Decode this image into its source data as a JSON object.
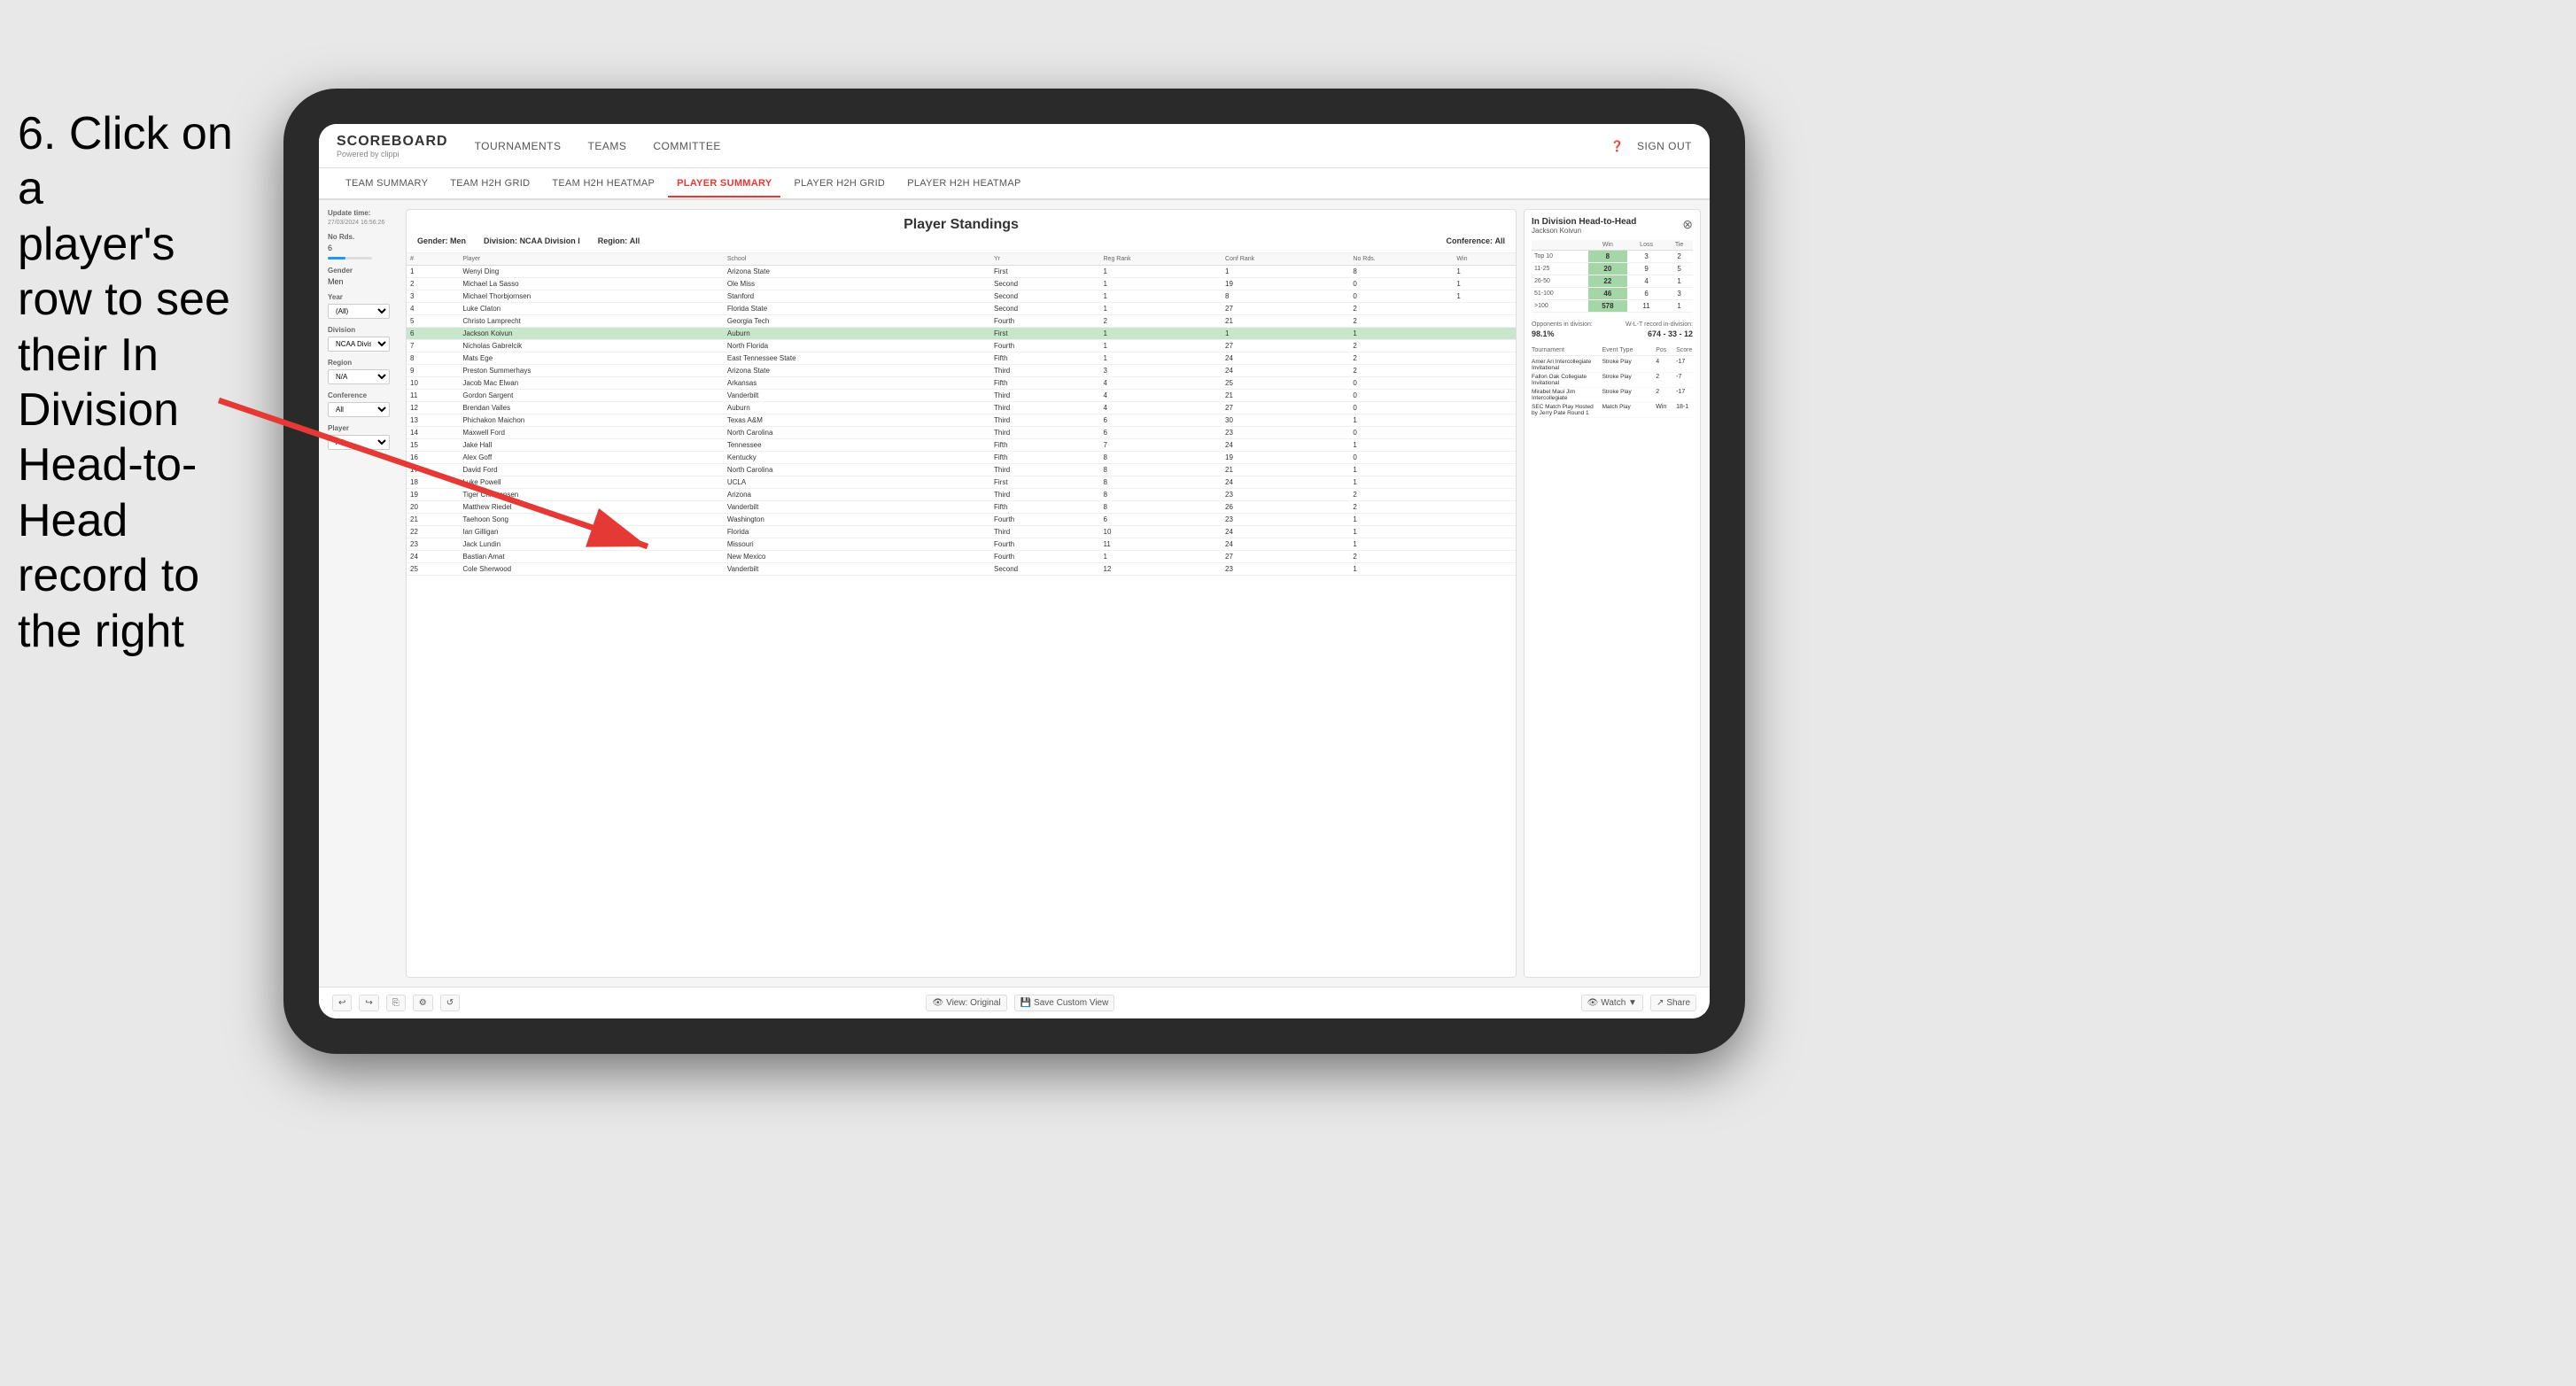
{
  "instruction": {
    "line1": "6. Click on a",
    "line2": "player's row to see",
    "line3": "their In Division",
    "line4": "Head-to-Head",
    "line5": "record to the right"
  },
  "nav": {
    "logo": "SCOREBOARD",
    "logo_sub": "Powered by clippi",
    "items": [
      "TOURNAMENTS",
      "TEAMS",
      "COMMITTEE"
    ],
    "sign_out": "Sign out"
  },
  "sub_nav": {
    "items": [
      "TEAM SUMMARY",
      "TEAM H2H GRID",
      "TEAM H2H HEATMAP",
      "PLAYER SUMMARY",
      "PLAYER H2H GRID",
      "PLAYER H2H HEATMAP"
    ],
    "active": "PLAYER SUMMARY"
  },
  "sidebar": {
    "update_label": "Update time:",
    "update_time": "27/03/2024 16:56:26",
    "no_rds_label": "No Rds.",
    "no_rds_value": "6",
    "gender_label": "Gender",
    "gender_value": "Men",
    "year_label": "Year",
    "year_value": "(All)",
    "division_label": "Division",
    "division_value": "NCAA Division I",
    "region_label": "Region",
    "region_value": "N/A",
    "conference_label": "Conference",
    "conference_value": "(All)",
    "player_label": "Player",
    "player_value": "(All)"
  },
  "standings": {
    "title": "Player Standings",
    "filters": {
      "gender_label": "Gender:",
      "gender_value": "Men",
      "division_label": "Division:",
      "division_value": "NCAA Division I",
      "region_label": "Region:",
      "region_value": "All",
      "conference_label": "Conference:",
      "conference_value": "All"
    },
    "columns": [
      "#",
      "Player",
      "School",
      "Yr",
      "Reg Rank",
      "Conf Rank",
      "No Rds.",
      "Win"
    ],
    "rows": [
      {
        "num": "1",
        "player": "Wenyi Ding",
        "school": "Arizona State",
        "yr": "First",
        "reg": "1",
        "conf": "1",
        "rds": "8",
        "win": "1"
      },
      {
        "num": "2",
        "player": "Michael La Sasso",
        "school": "Ole Miss",
        "yr": "Second",
        "reg": "1",
        "conf": "19",
        "rds": "0",
        "win": "1"
      },
      {
        "num": "3",
        "player": "Michael Thorbjornsen",
        "school": "Stanford",
        "yr": "Second",
        "reg": "1",
        "conf": "8",
        "rds": "0",
        "win": "1"
      },
      {
        "num": "4",
        "player": "Luke Claton",
        "school": "Florida State",
        "yr": "Second",
        "reg": "1",
        "conf": "27",
        "rds": "2",
        "win": ""
      },
      {
        "num": "5",
        "player": "Christo Lamprecht",
        "school": "Georgia Tech",
        "yr": "Fourth",
        "reg": "2",
        "conf": "21",
        "rds": "2",
        "win": ""
      },
      {
        "num": "6",
        "player": "Jackson Koivun",
        "school": "Auburn",
        "yr": "First",
        "reg": "1",
        "conf": "1",
        "rds": "1",
        "win": "",
        "highlighted": true
      },
      {
        "num": "7",
        "player": "Nicholas Gabrelcik",
        "school": "North Florida",
        "yr": "Fourth",
        "reg": "1",
        "conf": "27",
        "rds": "2",
        "win": ""
      },
      {
        "num": "8",
        "player": "Mats Ege",
        "school": "East Tennessee State",
        "yr": "Fifth",
        "reg": "1",
        "conf": "24",
        "rds": "2",
        "win": ""
      },
      {
        "num": "9",
        "player": "Preston Summerhays",
        "school": "Arizona State",
        "yr": "Third",
        "reg": "3",
        "conf": "24",
        "rds": "2",
        "win": ""
      },
      {
        "num": "10",
        "player": "Jacob Mac Elwan",
        "school": "Arkansas",
        "yr": "Fifth",
        "reg": "4",
        "conf": "25",
        "rds": "0",
        "win": ""
      },
      {
        "num": "11",
        "player": "Gordon Sargent",
        "school": "Vanderbilt",
        "yr": "Third",
        "reg": "4",
        "conf": "21",
        "rds": "0",
        "win": ""
      },
      {
        "num": "12",
        "player": "Brendan Valles",
        "school": "Auburn",
        "yr": "Third",
        "reg": "4",
        "conf": "27",
        "rds": "0",
        "win": ""
      },
      {
        "num": "13",
        "player": "Phichakon Maichon",
        "school": "Texas A&M",
        "yr": "Third",
        "reg": "6",
        "conf": "30",
        "rds": "1",
        "win": ""
      },
      {
        "num": "14",
        "player": "Maxwell Ford",
        "school": "North Carolina",
        "yr": "Third",
        "reg": "6",
        "conf": "23",
        "rds": "0",
        "win": ""
      },
      {
        "num": "15",
        "player": "Jake Hall",
        "school": "Tennessee",
        "yr": "Fifth",
        "reg": "7",
        "conf": "24",
        "rds": "1",
        "win": ""
      },
      {
        "num": "16",
        "player": "Alex Goff",
        "school": "Kentucky",
        "yr": "Fifth",
        "reg": "8",
        "conf": "19",
        "rds": "0",
        "win": ""
      },
      {
        "num": "17",
        "player": "David Ford",
        "school": "North Carolina",
        "yr": "Third",
        "reg": "8",
        "conf": "21",
        "rds": "1",
        "win": ""
      },
      {
        "num": "18",
        "player": "Luke Powell",
        "school": "UCLA",
        "yr": "First",
        "reg": "8",
        "conf": "24",
        "rds": "1",
        "win": ""
      },
      {
        "num": "19",
        "player": "Tiger Christensen",
        "school": "Arizona",
        "yr": "Third",
        "reg": "8",
        "conf": "23",
        "rds": "2",
        "win": ""
      },
      {
        "num": "20",
        "player": "Matthew Riedel",
        "school": "Vanderbilt",
        "yr": "Fifth",
        "reg": "8",
        "conf": "26",
        "rds": "2",
        "win": ""
      },
      {
        "num": "21",
        "player": "Taehoon Song",
        "school": "Washington",
        "yr": "Fourth",
        "reg": "6",
        "conf": "23",
        "rds": "1",
        "win": ""
      },
      {
        "num": "22",
        "player": "Ian Gilligan",
        "school": "Florida",
        "yr": "Third",
        "reg": "10",
        "conf": "24",
        "rds": "1",
        "win": ""
      },
      {
        "num": "23",
        "player": "Jack Lundin",
        "school": "Missouri",
        "yr": "Fourth",
        "reg": "11",
        "conf": "24",
        "rds": "1",
        "win": ""
      },
      {
        "num": "24",
        "player": "Bastian Amat",
        "school": "New Mexico",
        "yr": "Fourth",
        "reg": "1",
        "conf": "27",
        "rds": "2",
        "win": ""
      },
      {
        "num": "25",
        "player": "Cole Sherwood",
        "school": "Vanderbilt",
        "yr": "Second",
        "reg": "12",
        "conf": "23",
        "rds": "1",
        "win": ""
      }
    ]
  },
  "right_panel": {
    "title": "In Division Head-to-Head",
    "player_name": "Jackson Koivun",
    "h2h_columns": [
      "Win",
      "Loss",
      "Tie"
    ],
    "h2h_rows": [
      {
        "label": "Top 10",
        "win": "8",
        "loss": "3",
        "tie": "2",
        "win_green": true
      },
      {
        "label": "11-25",
        "win": "20",
        "loss": "9",
        "tie": "5",
        "win_green": true
      },
      {
        "label": "26-50",
        "win": "22",
        "loss": "4",
        "tie": "1",
        "win_green": true
      },
      {
        "label": "51-100",
        "win": "46",
        "loss": "6",
        "tie": "3",
        "win_green": true
      },
      {
        "label": ">100",
        "win": "578",
        "loss": "11",
        "tie": "1",
        "win_green": true
      }
    ],
    "opponents_label": "Opponents in division:",
    "wl_label": "W-L-T record in-division:",
    "opponents_value": "98.1%",
    "wl_value": "674 - 33 - 12",
    "tournament_columns": [
      "Tournament",
      "Event Type",
      "Pos",
      "Score"
    ],
    "tournament_rows": [
      {
        "tournament": "Amer Ari Intercollegiate Invitational",
        "event_type": "Stroke Play",
        "pos": "4",
        "score": "-17"
      },
      {
        "tournament": "Fallon Oak Collegiate Invitational",
        "event_type": "Stroke Play",
        "pos": "2",
        "score": "-7"
      },
      {
        "tournament": "Mirabel Maui Jim Intercollegiate",
        "event_type": "Stroke Play",
        "pos": "2",
        "score": "-17"
      },
      {
        "tournament": "SEC Match Play Hosted by Jerry Pate Round 1",
        "event_type": "Match Play",
        "pos": "Win",
        "score": "18-1"
      }
    ]
  },
  "toolbar": {
    "undo": "↩",
    "redo": "↪",
    "view_original": "View: Original",
    "save_custom": "Save Custom View",
    "watch": "Watch ▼",
    "share": "Share"
  }
}
